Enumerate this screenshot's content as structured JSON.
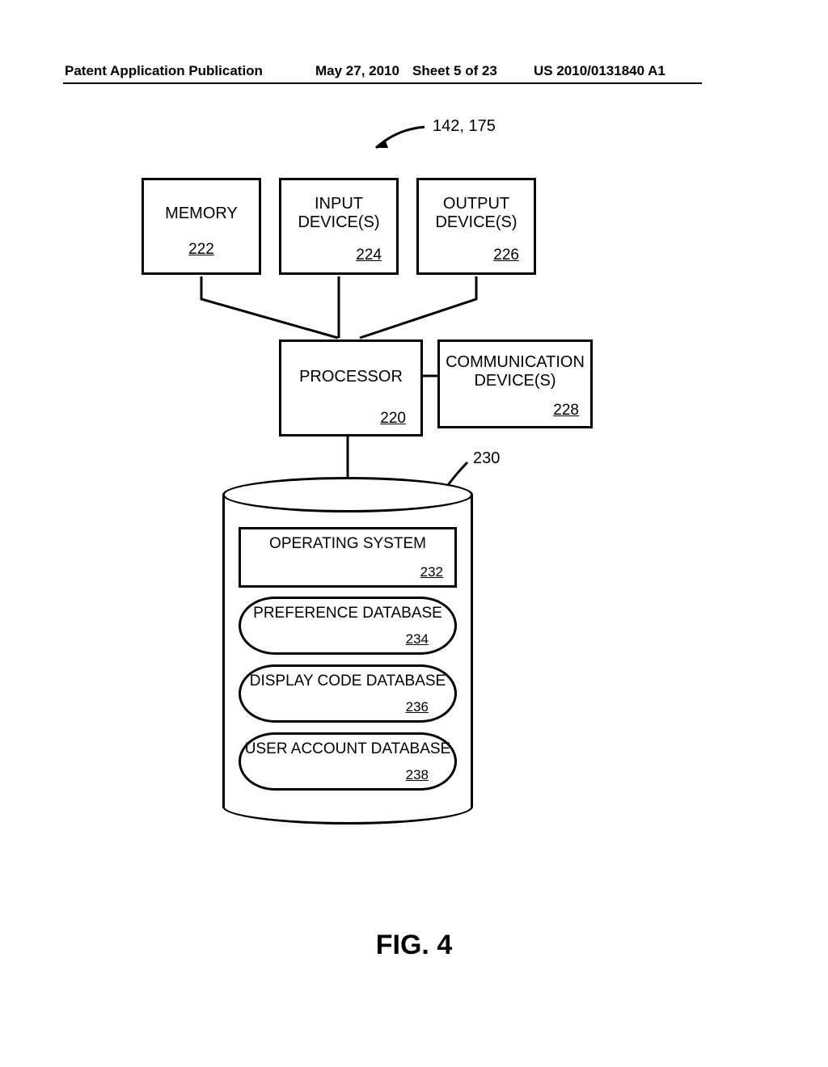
{
  "header": {
    "pub_label": "Patent Application Publication",
    "pub_date": "May 27, 2010",
    "sheet": "Sheet 5 of 23",
    "pub_num": "US 2010/0131840 A1"
  },
  "refs": {
    "top_ref": "142, 175",
    "storage_ref": "230"
  },
  "blocks": {
    "memory": {
      "label": "MEMORY",
      "num": "222"
    },
    "input": {
      "label": "INPUT DEVICE(S)",
      "num": "224"
    },
    "output": {
      "label": "OUTPUT DEVICE(S)",
      "num": "226"
    },
    "processor": {
      "label": "PROCESSOR",
      "num": "220"
    },
    "comm": {
      "label": "COMMUNICATION DEVICE(S)",
      "num": "228"
    }
  },
  "storage": {
    "os": {
      "label": "OPERATING SYSTEM",
      "num": "232"
    },
    "pref": {
      "label": "PREFERENCE DATABASE",
      "num": "234"
    },
    "disp": {
      "label": "DISPLAY CODE DATABASE",
      "num": "236"
    },
    "user": {
      "label": "USER ACCOUNT DATABASE",
      "num": "238"
    }
  },
  "figure": "FIG. 4"
}
